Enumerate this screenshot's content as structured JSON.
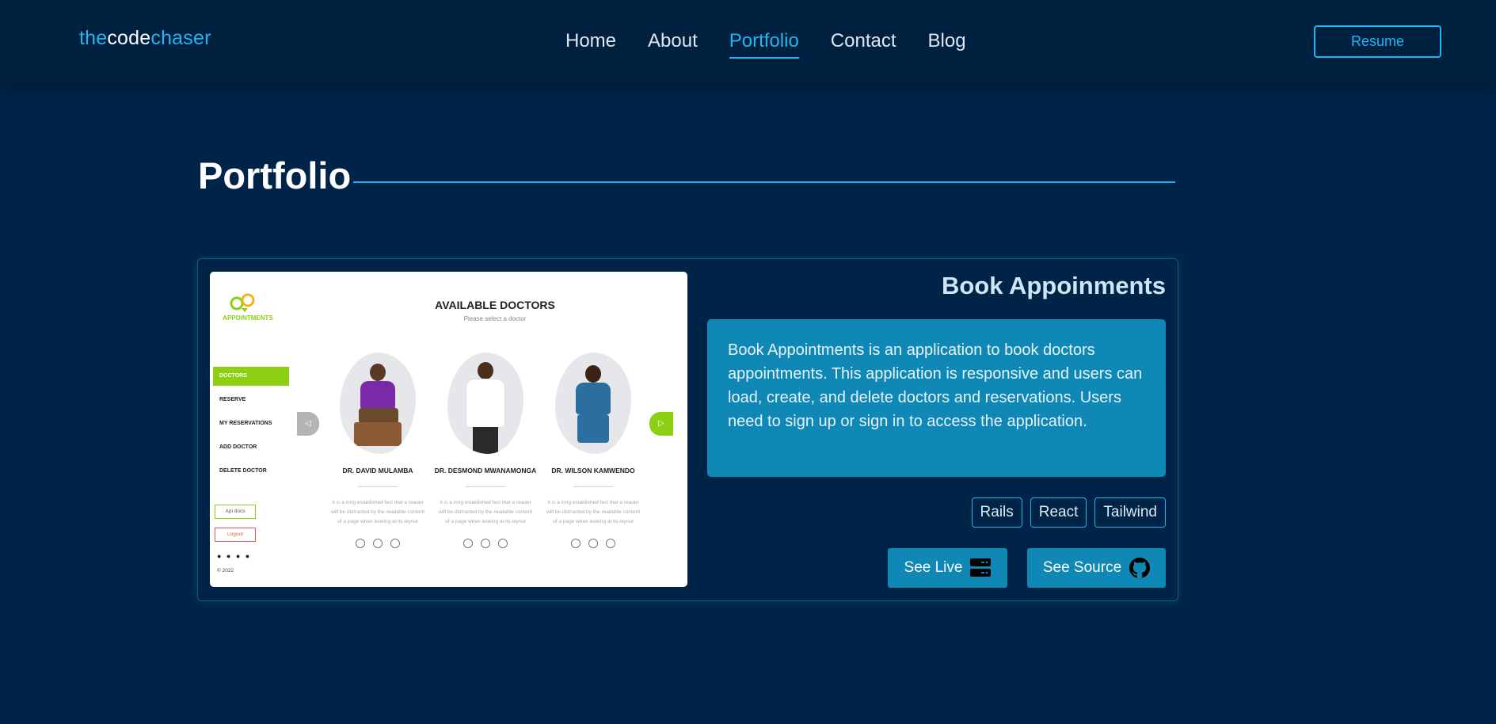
{
  "header": {
    "logo": {
      "part1": "the",
      "part2": "code",
      "part3": "chaser"
    },
    "nav": [
      {
        "label": "Home",
        "active": false
      },
      {
        "label": "About",
        "active": false
      },
      {
        "label": "Portfolio",
        "active": true
      },
      {
        "label": "Contact",
        "active": false
      },
      {
        "label": "Blog",
        "active": false
      }
    ],
    "resume_label": "Resume"
  },
  "section": {
    "title": "Portfolio"
  },
  "project": {
    "title": "Book Appoinments",
    "description": "Book Appointments is an application to book doctors appointments. This application is responsive and users can load, create, and delete doctors and reservations. Users need to sign up or sign in to access the application.",
    "tags": [
      "Rails",
      "React",
      "Tailwind"
    ],
    "see_live_label": "See Live",
    "see_source_label": "See Source",
    "live_icon": "server-icon",
    "source_icon": "github-icon"
  },
  "thumbnail": {
    "brand": "APPOINTMENTS",
    "heading": "AVAILABLE DOCTORS",
    "subheading": "Please select a doctor",
    "menu": [
      "DOCTORS",
      "RESERVE",
      "MY RESERVATIONS",
      "ADD DOCTOR",
      "DELETE DOCTOR"
    ],
    "api_docs": "Api docs",
    "logout": "Logout",
    "copyright": "© 2022",
    "doctors": [
      {
        "name": "DR. DAVID MULAMBA",
        "shirt": "#7a2aa8",
        "pants": "#6b4a2a"
      },
      {
        "name": "DR. DESMOND MWANAMONGA",
        "shirt": "#ffffff",
        "pants": "#2a2a2a"
      },
      {
        "name": "DR. WILSON KAMWENDO",
        "shirt": "#2b6fa0",
        "pants": "#2b6fa0"
      }
    ],
    "doctor_text": "It is a long established fact that a reader will be distracted by the readable content of a page when looking at its layout"
  },
  "colors": {
    "background": "#002447",
    "accent": "#1fb6f2",
    "panel": "#1088b5",
    "thumb_green": "#8ccf13"
  }
}
